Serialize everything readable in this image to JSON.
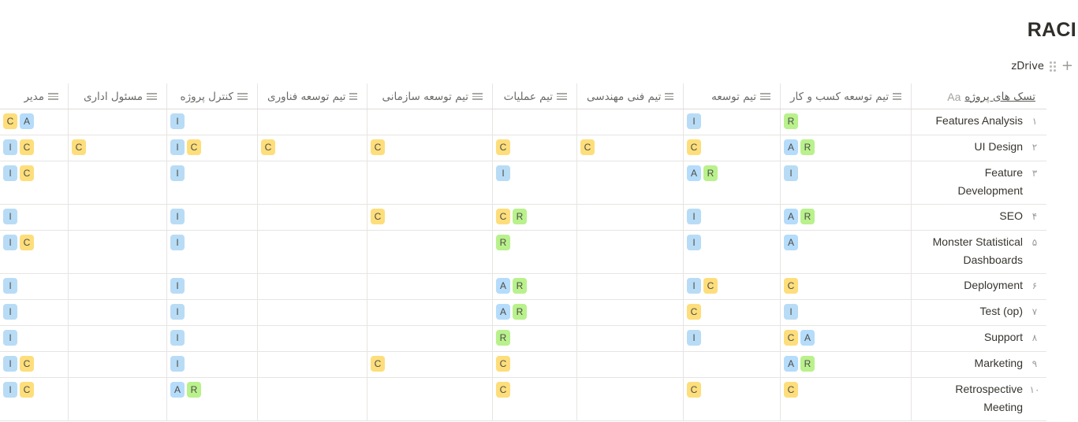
{
  "page": {
    "title": "RACI"
  },
  "view": {
    "label": "zDrive",
    "plus": "+"
  },
  "table": {
    "title_column": "تسک های پروژه",
    "title_icon": "Aa",
    "columns": [
      "تیم توسعه کسب و کار",
      "تیم توسعه",
      "تیم فنی مهندسی",
      "تیم عملیات",
      "تیم توسعه سازمانی",
      "تیم توسعه فناوری",
      "کنترل پروژه",
      "مسئول اداری",
      "مدیر"
    ],
    "tag_colors": {
      "R": "#b9f18c",
      "A": "#b5dcfa",
      "C": "#fdde7b",
      "I": "#b8dcf5"
    },
    "rows": [
      {
        "num": "۱",
        "name": "Features Analysis",
        "cells": [
          [
            "R"
          ],
          [
            "I"
          ],
          [],
          [],
          [],
          [],
          [
            "I"
          ],
          [],
          [
            "A",
            "C"
          ]
        ]
      },
      {
        "num": "۲",
        "name": "UI Design",
        "cells": [
          [
            "R",
            "A"
          ],
          [
            "C"
          ],
          [
            "C"
          ],
          [
            "C"
          ],
          [
            "C"
          ],
          [
            "C"
          ],
          [
            "C",
            "I"
          ],
          [
            "C"
          ],
          [
            "C",
            "I"
          ]
        ]
      },
      {
        "num": "۳",
        "name": "Feature Development",
        "cells": [
          [
            "I"
          ],
          [
            "R",
            "A"
          ],
          [],
          [
            "I"
          ],
          [],
          [],
          [
            "I"
          ],
          [],
          [
            "C",
            "I"
          ]
        ]
      },
      {
        "num": "۴",
        "name": "SEO",
        "cells": [
          [
            "R",
            "A"
          ],
          [
            "I"
          ],
          [],
          [
            "R",
            "C"
          ],
          [
            "C"
          ],
          [],
          [
            "I"
          ],
          [],
          [
            "I"
          ]
        ]
      },
      {
        "num": "۵",
        "name": "Monster Statistical Dashboards",
        "cells": [
          [
            "A"
          ],
          [
            "I"
          ],
          [],
          [
            "R"
          ],
          [],
          [],
          [
            "I"
          ],
          [],
          [
            "C",
            "I"
          ]
        ]
      },
      {
        "num": "۶",
        "name": "Deployment",
        "cells": [
          [
            "C"
          ],
          [
            "C",
            "I"
          ],
          [],
          [
            "R",
            "A"
          ],
          [],
          [],
          [
            "I"
          ],
          [],
          [
            "I"
          ]
        ]
      },
      {
        "num": "۷",
        "name": "Test (op)",
        "cells": [
          [
            "I"
          ],
          [
            "C"
          ],
          [],
          [
            "R",
            "A"
          ],
          [],
          [],
          [
            "I"
          ],
          [],
          [
            "I"
          ]
        ]
      },
      {
        "num": "۸",
        "name": "Support",
        "cells": [
          [
            "A",
            "C"
          ],
          [
            "I"
          ],
          [],
          [
            "R"
          ],
          [],
          [],
          [
            "I"
          ],
          [],
          [
            "I"
          ]
        ]
      },
      {
        "num": "۹",
        "name": "Marketing",
        "cells": [
          [
            "R",
            "A"
          ],
          [],
          [],
          [
            "C"
          ],
          [
            "C"
          ],
          [],
          [
            "I"
          ],
          [],
          [
            "C",
            "I"
          ]
        ]
      },
      {
        "num": "۱۰",
        "name": "Retrospective Meeting",
        "cells": [
          [
            "C"
          ],
          [
            "C"
          ],
          [],
          [
            "C"
          ],
          [],
          [],
          [
            "R",
            "A"
          ],
          [],
          [
            "C",
            "I"
          ]
        ]
      }
    ]
  }
}
